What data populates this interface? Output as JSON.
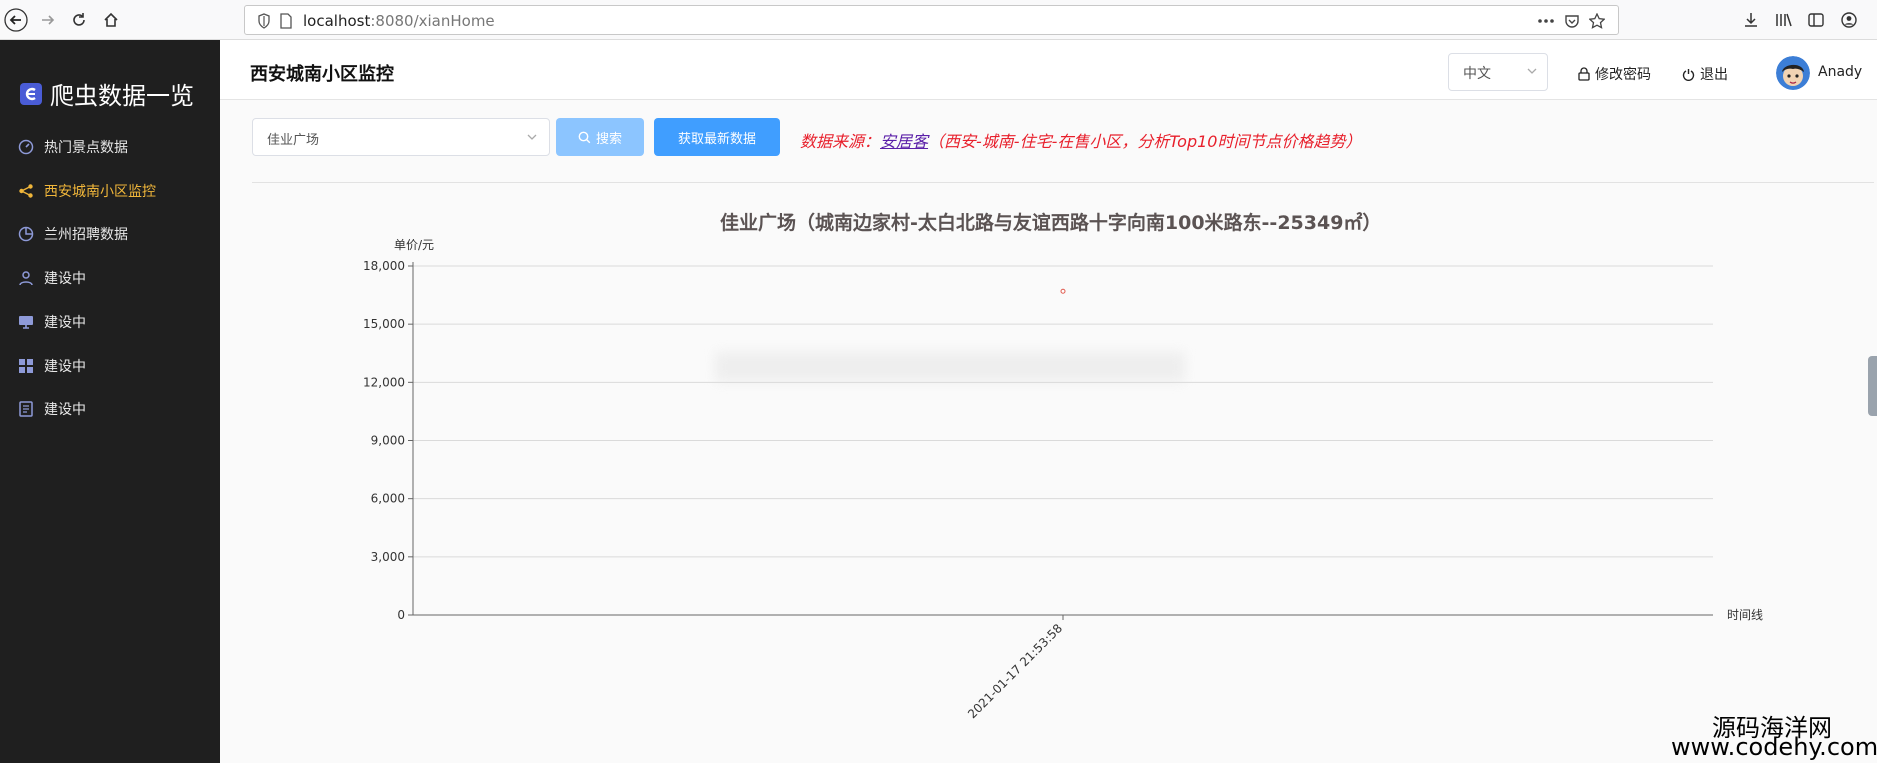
{
  "browser": {
    "url_host": "localhost",
    "url_rest": ":8080/xianHome",
    "colors": {
      "chrome_bg": "#f9f9fa"
    }
  },
  "sidebar": {
    "brand": "爬虫数据一览",
    "items": [
      {
        "label": "热门景点数据",
        "icon": "dashboard-icon",
        "active": false
      },
      {
        "label": "西安城南小区监控",
        "icon": "share-icon",
        "active": true
      },
      {
        "label": "兰州招聘数据",
        "icon": "pie-icon",
        "active": false
      },
      {
        "label": "建设中",
        "icon": "user-icon",
        "active": false
      },
      {
        "label": "建设中",
        "icon": "monitor-icon",
        "active": false
      },
      {
        "label": "建设中",
        "icon": "grid-icon",
        "active": false
      },
      {
        "label": "建设中",
        "icon": "document-icon",
        "active": false
      }
    ],
    "colors": {
      "bg": "#1f1f1f",
      "active": "#f0b63a"
    }
  },
  "header": {
    "title": "西安城南小区监控",
    "language": "中文",
    "change_password": "修改密码",
    "logout": "退出",
    "user": "Anady"
  },
  "toolbar": {
    "selected_community": "佳业广场",
    "search_label": "搜索",
    "fetch_label": "获取最新数据",
    "source_prefix": "数据来源：",
    "source_link": "安居客",
    "source_suffix": "（西安-城南-住宅-在售小区，分析Top10时间节点价格趋势）",
    "colors": {
      "primary": "#409eff",
      "primary_light": "#8cc5ff",
      "source_text": "#e8202c"
    }
  },
  "chart_data": {
    "type": "line",
    "title": "佳业广场（城南边家村-太白北路与友谊西路十字向南100米路东--25349㎡）",
    "ylabel": "单价/元",
    "xlabel": "时间线",
    "ylim": [
      0,
      18000
    ],
    "yticks": [
      0,
      3000,
      6000,
      9000,
      12000,
      15000,
      18000
    ],
    "ytick_labels": [
      "0",
      "3,000",
      "6,000",
      "9,000",
      "12,000",
      "15,000",
      "18,000"
    ],
    "categories": [
      "2021-01-17 21:53:58"
    ],
    "series": [
      {
        "values": [
          16700
        ]
      }
    ],
    "grid": true,
    "point_color": "#e05a4e"
  },
  "watermark": {
    "name": "源码海洋网",
    "url": "www.codehy.com"
  }
}
